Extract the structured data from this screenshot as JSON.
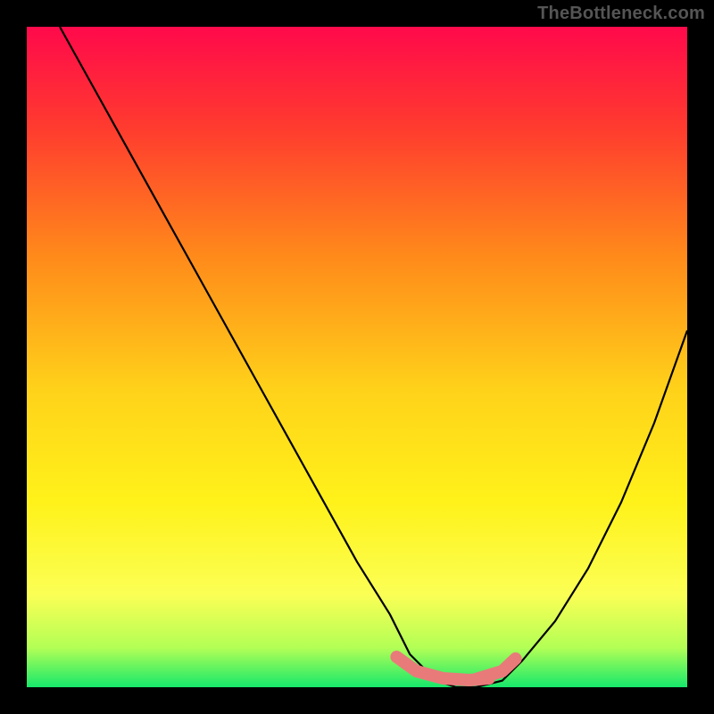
{
  "watermark": "TheBottleneck.com",
  "chart_data": {
    "type": "line",
    "title": "",
    "xlabel": "",
    "ylabel": "",
    "xlim": [
      0,
      100
    ],
    "ylim": [
      0,
      100
    ],
    "series": [
      {
        "name": "curve",
        "x": [
          5,
          10,
          15,
          20,
          25,
          30,
          35,
          40,
          45,
          50,
          55,
          58,
          62,
          65,
          68,
          72,
          75,
          80,
          85,
          90,
          95,
          100
        ],
        "values": [
          100,
          91,
          82,
          73,
          64,
          55,
          46,
          37,
          28,
          19,
          11,
          5,
          1,
          0,
          0,
          1,
          4,
          10,
          18,
          28,
          40,
          54
        ]
      }
    ],
    "flat_region": {
      "x_start": 56,
      "x_end": 74,
      "y": 0
    },
    "gradient_stops": [
      {
        "offset": 0.0,
        "color": "#ff094b"
      },
      {
        "offset": 0.15,
        "color": "#ff3a2f"
      },
      {
        "offset": 0.35,
        "color": "#ff8b1a"
      },
      {
        "offset": 0.55,
        "color": "#ffd21a"
      },
      {
        "offset": 0.72,
        "color": "#fff21a"
      },
      {
        "offset": 0.86,
        "color": "#fbff55"
      },
      {
        "offset": 0.94,
        "color": "#b3ff55"
      },
      {
        "offset": 1.0,
        "color": "#16e86b"
      }
    ]
  }
}
